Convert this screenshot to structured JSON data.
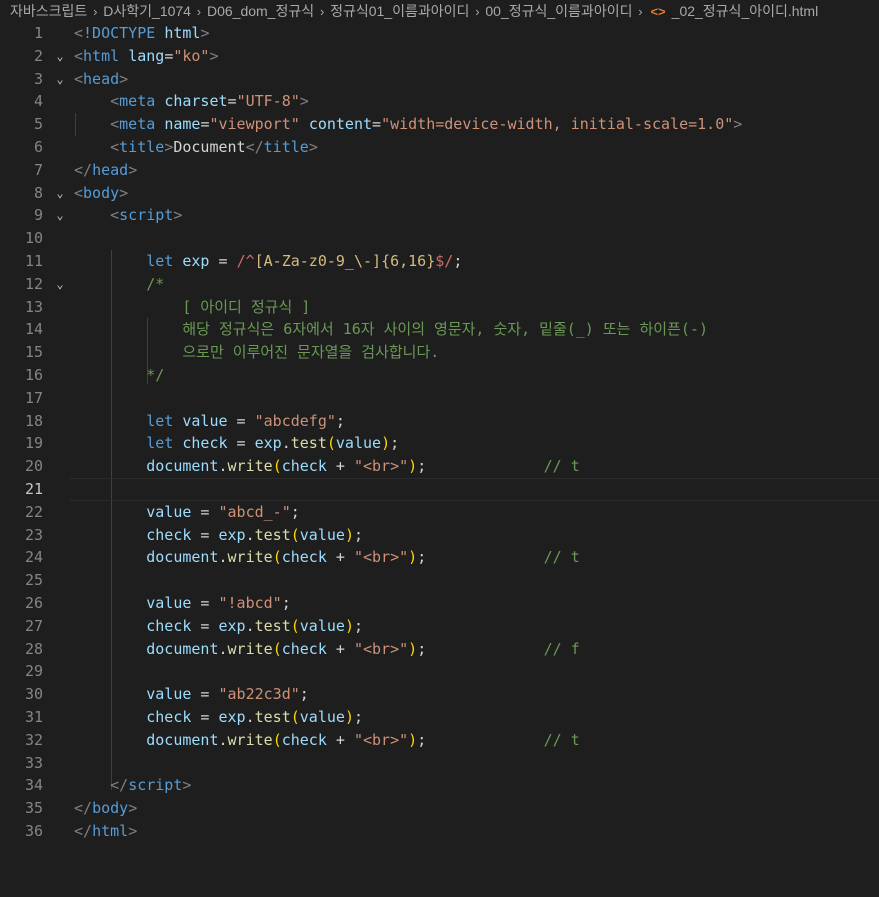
{
  "breadcrumb": {
    "items": [
      "자바스크립트",
      "D사학기_1074",
      "D06_dom_정규식",
      "정규식01_이름과아이디",
      "00_정규식_이름과아이디"
    ],
    "file": "_02_정규식_아이디.html"
  },
  "colors": {
    "background": "#1e1e1e",
    "keyword": "#569cd6",
    "string": "#ce9178",
    "comment": "#6a9955",
    "function": "#dcdcaa",
    "variable": "#9cdcfe"
  },
  "editor": {
    "active_line": 21,
    "lines": [
      {
        "n": "1",
        "fold": "",
        "tokens": [
          [
            "t-punct",
            "<"
          ],
          [
            "t-tag",
            "!DOCTYPE"
          ],
          [
            "t-text",
            " "
          ],
          [
            "t-attr",
            "html"
          ],
          [
            "t-punct",
            ">"
          ]
        ]
      },
      {
        "n": "2",
        "fold": "v",
        "tokens": [
          [
            "t-punct",
            "<"
          ],
          [
            "t-tag",
            "html"
          ],
          [
            "t-text",
            " "
          ],
          [
            "t-attr",
            "lang"
          ],
          [
            "t-text",
            "="
          ],
          [
            "t-str",
            "\"ko\""
          ],
          [
            "t-punct",
            ">"
          ]
        ]
      },
      {
        "n": "3",
        "fold": "v",
        "tokens": [
          [
            "t-punct",
            "<"
          ],
          [
            "t-tag",
            "head"
          ],
          [
            "t-punct",
            ">"
          ]
        ]
      },
      {
        "n": "4",
        "fold": "",
        "tokens": [
          [
            "t-text",
            "    "
          ],
          [
            "t-punct",
            "<"
          ],
          [
            "t-tag",
            "meta"
          ],
          [
            "t-text",
            " "
          ],
          [
            "t-attr",
            "charset"
          ],
          [
            "t-text",
            "="
          ],
          [
            "t-str",
            "\"UTF-8\""
          ],
          [
            "t-punct",
            ">"
          ]
        ]
      },
      {
        "n": "5",
        "fold": "",
        "tokens": [
          [
            "t-text",
            "    "
          ],
          [
            "t-punct",
            "<"
          ],
          [
            "t-tag",
            "meta"
          ],
          [
            "t-text",
            " "
          ],
          [
            "t-attr",
            "name"
          ],
          [
            "t-text",
            "="
          ],
          [
            "t-str",
            "\"viewport\""
          ],
          [
            "t-text",
            " "
          ],
          [
            "t-attr",
            "content"
          ],
          [
            "t-text",
            "="
          ],
          [
            "t-str",
            "\"width=device-width, initial-scale=1.0\""
          ],
          [
            "t-punct",
            ">"
          ]
        ]
      },
      {
        "n": "6",
        "fold": "",
        "tokens": [
          [
            "t-text",
            "    "
          ],
          [
            "t-punct",
            "<"
          ],
          [
            "t-tag",
            "title"
          ],
          [
            "t-punct",
            ">"
          ],
          [
            "t-text",
            "Document"
          ],
          [
            "t-punct",
            "</"
          ],
          [
            "t-tag",
            "title"
          ],
          [
            "t-punct",
            ">"
          ]
        ]
      },
      {
        "n": "7",
        "fold": "",
        "tokens": [
          [
            "t-punct",
            "</"
          ],
          [
            "t-tag",
            "head"
          ],
          [
            "t-punct",
            ">"
          ]
        ]
      },
      {
        "n": "8",
        "fold": "v",
        "tokens": [
          [
            "t-punct",
            "<"
          ],
          [
            "t-tag",
            "body"
          ],
          [
            "t-punct",
            ">"
          ]
        ]
      },
      {
        "n": "9",
        "fold": "v",
        "tokens": [
          [
            "t-text",
            "    "
          ],
          [
            "t-punct",
            "<"
          ],
          [
            "t-tag",
            "script"
          ],
          [
            "t-punct",
            ">"
          ]
        ]
      },
      {
        "n": "10",
        "fold": "",
        "tokens": []
      },
      {
        "n": "11",
        "fold": "",
        "tokens": [
          [
            "t-text",
            "        "
          ],
          [
            "t-kw",
            "let"
          ],
          [
            "t-text",
            " "
          ],
          [
            "t-var",
            "exp"
          ],
          [
            "t-op",
            " = "
          ],
          [
            "t-regex",
            "/^"
          ],
          [
            "t-regex-c",
            "[A-Za-z0-9_\\-]"
          ],
          [
            "t-regex-c",
            "{6,16}"
          ],
          [
            "t-regex",
            "$/"
          ],
          [
            "t-text",
            ";"
          ]
        ]
      },
      {
        "n": "12",
        "fold": "v",
        "tokens": [
          [
            "t-text",
            "        "
          ],
          [
            "t-cmt",
            "/*"
          ]
        ]
      },
      {
        "n": "13",
        "fold": "",
        "tokens": [
          [
            "t-text",
            "            "
          ],
          [
            "t-cmt",
            "[ 아이디 정규식 ]"
          ]
        ]
      },
      {
        "n": "14",
        "fold": "",
        "tokens": [
          [
            "t-text",
            "            "
          ],
          [
            "t-cmt",
            "해당 정규식은 6자에서 16자 사이의 영문자, 숫자, 밑줄(_) 또는 하이픈(-)"
          ]
        ]
      },
      {
        "n": "15",
        "fold": "",
        "tokens": [
          [
            "t-text",
            "            "
          ],
          [
            "t-cmt",
            "으로만 이루어진 문자열을 검사합니다."
          ]
        ]
      },
      {
        "n": "16",
        "fold": "",
        "tokens": [
          [
            "t-text",
            "        "
          ],
          [
            "t-cmt",
            "*/"
          ]
        ]
      },
      {
        "n": "17",
        "fold": "",
        "tokens": []
      },
      {
        "n": "18",
        "fold": "",
        "tokens": [
          [
            "t-text",
            "        "
          ],
          [
            "t-kw",
            "let"
          ],
          [
            "t-text",
            " "
          ],
          [
            "t-var",
            "value"
          ],
          [
            "t-op",
            " = "
          ],
          [
            "t-str",
            "\"abcdefg\""
          ],
          [
            "t-text",
            ";"
          ]
        ]
      },
      {
        "n": "19",
        "fold": "",
        "tokens": [
          [
            "t-text",
            "        "
          ],
          [
            "t-kw",
            "let"
          ],
          [
            "t-text",
            " "
          ],
          [
            "t-var",
            "check"
          ],
          [
            "t-op",
            " = "
          ],
          [
            "t-var",
            "exp"
          ],
          [
            "t-text",
            "."
          ],
          [
            "t-fn",
            "test"
          ],
          [
            "t-paren",
            "("
          ],
          [
            "t-var",
            "value"
          ],
          [
            "t-paren",
            ")"
          ],
          [
            "t-text",
            ";"
          ]
        ]
      },
      {
        "n": "20",
        "fold": "",
        "tokens": [
          [
            "t-text",
            "        "
          ],
          [
            "t-var",
            "document"
          ],
          [
            "t-text",
            "."
          ],
          [
            "t-fn",
            "write"
          ],
          [
            "t-paren",
            "("
          ],
          [
            "t-var",
            "check"
          ],
          [
            "t-op",
            " + "
          ],
          [
            "t-str",
            "\"<br>\""
          ],
          [
            "t-paren",
            ")"
          ],
          [
            "t-text",
            ";"
          ],
          [
            "t-text",
            "             "
          ],
          [
            "t-cmt",
            "// t"
          ]
        ]
      },
      {
        "n": "21",
        "fold": "",
        "tokens": []
      },
      {
        "n": "22",
        "fold": "",
        "tokens": [
          [
            "t-text",
            "        "
          ],
          [
            "t-var",
            "value"
          ],
          [
            "t-op",
            " = "
          ],
          [
            "t-str",
            "\"abcd_-\""
          ],
          [
            "t-text",
            ";"
          ]
        ]
      },
      {
        "n": "23",
        "fold": "",
        "tokens": [
          [
            "t-text",
            "        "
          ],
          [
            "t-var",
            "check"
          ],
          [
            "t-op",
            " = "
          ],
          [
            "t-var",
            "exp"
          ],
          [
            "t-text",
            "."
          ],
          [
            "t-fn",
            "test"
          ],
          [
            "t-paren",
            "("
          ],
          [
            "t-var",
            "value"
          ],
          [
            "t-paren",
            ")"
          ],
          [
            "t-text",
            ";"
          ]
        ]
      },
      {
        "n": "24",
        "fold": "",
        "tokens": [
          [
            "t-text",
            "        "
          ],
          [
            "t-var",
            "document"
          ],
          [
            "t-text",
            "."
          ],
          [
            "t-fn",
            "write"
          ],
          [
            "t-paren",
            "("
          ],
          [
            "t-var",
            "check"
          ],
          [
            "t-op",
            " + "
          ],
          [
            "t-str",
            "\"<br>\""
          ],
          [
            "t-paren",
            ")"
          ],
          [
            "t-text",
            ";"
          ],
          [
            "t-text",
            "             "
          ],
          [
            "t-cmt",
            "// t"
          ]
        ]
      },
      {
        "n": "25",
        "fold": "",
        "tokens": []
      },
      {
        "n": "26",
        "fold": "",
        "tokens": [
          [
            "t-text",
            "        "
          ],
          [
            "t-var",
            "value"
          ],
          [
            "t-op",
            " = "
          ],
          [
            "t-str",
            "\"!abcd\""
          ],
          [
            "t-text",
            ";"
          ]
        ]
      },
      {
        "n": "27",
        "fold": "",
        "tokens": [
          [
            "t-text",
            "        "
          ],
          [
            "t-var",
            "check"
          ],
          [
            "t-op",
            " = "
          ],
          [
            "t-var",
            "exp"
          ],
          [
            "t-text",
            "."
          ],
          [
            "t-fn",
            "test"
          ],
          [
            "t-paren",
            "("
          ],
          [
            "t-var",
            "value"
          ],
          [
            "t-paren",
            ")"
          ],
          [
            "t-text",
            ";"
          ]
        ]
      },
      {
        "n": "28",
        "fold": "",
        "tokens": [
          [
            "t-text",
            "        "
          ],
          [
            "t-var",
            "document"
          ],
          [
            "t-text",
            "."
          ],
          [
            "t-fn",
            "write"
          ],
          [
            "t-paren",
            "("
          ],
          [
            "t-var",
            "check"
          ],
          [
            "t-op",
            " + "
          ],
          [
            "t-str",
            "\"<br>\""
          ],
          [
            "t-paren",
            ")"
          ],
          [
            "t-text",
            ";"
          ],
          [
            "t-text",
            "             "
          ],
          [
            "t-cmt",
            "// f"
          ]
        ]
      },
      {
        "n": "29",
        "fold": "",
        "tokens": []
      },
      {
        "n": "30",
        "fold": "",
        "tokens": [
          [
            "t-text",
            "        "
          ],
          [
            "t-var",
            "value"
          ],
          [
            "t-op",
            " = "
          ],
          [
            "t-str",
            "\"ab22c3d\""
          ],
          [
            "t-text",
            ";"
          ]
        ]
      },
      {
        "n": "31",
        "fold": "",
        "tokens": [
          [
            "t-text",
            "        "
          ],
          [
            "t-var",
            "check"
          ],
          [
            "t-op",
            " = "
          ],
          [
            "t-var",
            "exp"
          ],
          [
            "t-text",
            "."
          ],
          [
            "t-fn",
            "test"
          ],
          [
            "t-paren",
            "("
          ],
          [
            "t-var",
            "value"
          ],
          [
            "t-paren",
            ")"
          ],
          [
            "t-text",
            ";"
          ]
        ]
      },
      {
        "n": "32",
        "fold": "",
        "tokens": [
          [
            "t-text",
            "        "
          ],
          [
            "t-var",
            "document"
          ],
          [
            "t-text",
            "."
          ],
          [
            "t-fn",
            "write"
          ],
          [
            "t-paren",
            "("
          ],
          [
            "t-var",
            "check"
          ],
          [
            "t-op",
            " + "
          ],
          [
            "t-str",
            "\"<br>\""
          ],
          [
            "t-paren",
            ")"
          ],
          [
            "t-text",
            ";"
          ],
          [
            "t-text",
            "             "
          ],
          [
            "t-cmt",
            "// t"
          ]
        ]
      },
      {
        "n": "33",
        "fold": "",
        "tokens": []
      },
      {
        "n": "34",
        "fold": "",
        "tokens": [
          [
            "t-text",
            "    "
          ],
          [
            "t-punct",
            "</"
          ],
          [
            "t-tag",
            "script"
          ],
          [
            "t-punct",
            ">"
          ]
        ]
      },
      {
        "n": "35",
        "fold": "",
        "tokens": [
          [
            "t-punct",
            "</"
          ],
          [
            "t-tag",
            "body"
          ],
          [
            "t-punct",
            ">"
          ]
        ]
      },
      {
        "n": "36",
        "fold": "",
        "tokens": [
          [
            "t-punct",
            "</"
          ],
          [
            "t-tag",
            "html"
          ],
          [
            "t-punct",
            ">"
          ]
        ]
      }
    ]
  }
}
